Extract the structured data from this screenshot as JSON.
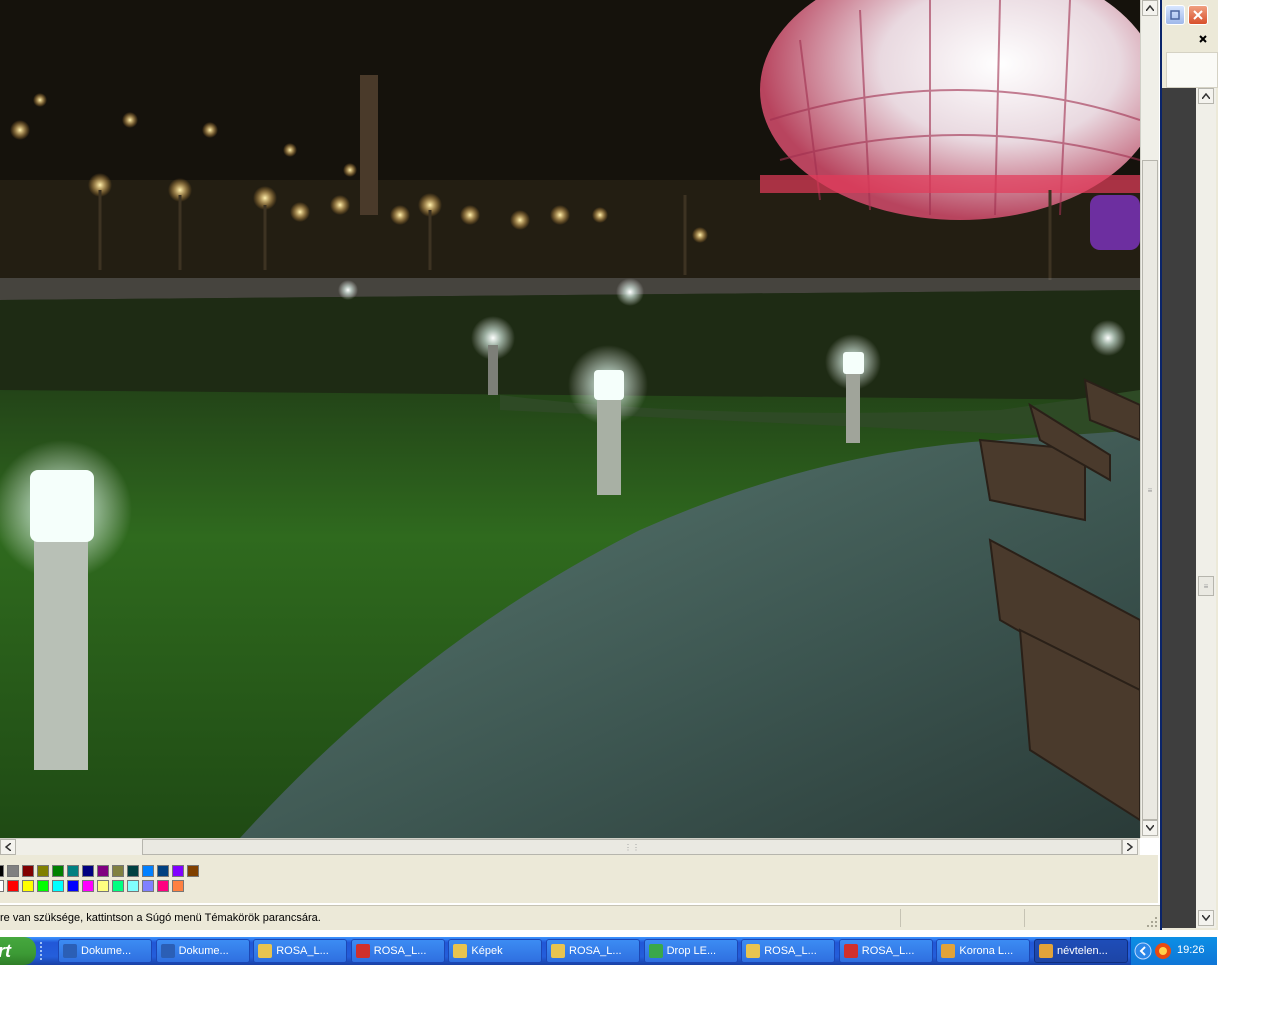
{
  "status_bar": {
    "help_text": "re van szüksége, kattintson a Súgó menü Témakörök parancsára."
  },
  "palette": {
    "row1": [
      "#000000",
      "#808080",
      "#800000",
      "#808000",
      "#008000",
      "#008080",
      "#000080",
      "#800080",
      "#808040",
      "#004040",
      "#0080ff",
      "#004080",
      "#8000ff",
      "#804000"
    ],
    "row2": [
      "#ffffff",
      "#ff0000",
      "#ffff00",
      "#00ff00",
      "#00ffff",
      "#0000ff",
      "#ff00ff",
      "#ffff80",
      "#00ff80",
      "#80ffff",
      "#8080ff",
      "#ff0080",
      "#ff8040"
    ]
  },
  "taskbar": {
    "start_label": "rt",
    "tasks": [
      {
        "label": "Dokume...",
        "icon": "word-icon"
      },
      {
        "label": "Dokume...",
        "icon": "word-icon"
      },
      {
        "label": "ROSA_L...",
        "icon": "folder-icon"
      },
      {
        "label": "ROSA_L...",
        "icon": "pdf-icon"
      },
      {
        "label": "Képek",
        "icon": "image-folder-icon"
      },
      {
        "label": "ROSA_L...",
        "icon": "folder-icon"
      },
      {
        "label": "Drop LE...",
        "icon": "chrome-icon"
      },
      {
        "label": "ROSA_L...",
        "icon": "folder-icon"
      },
      {
        "label": "ROSA_L...",
        "icon": "pdf-icon"
      },
      {
        "label": "Korona L...",
        "icon": "paint-icon"
      },
      {
        "label": "névtelen...",
        "icon": "paint-icon"
      }
    ],
    "clock": "19:26"
  },
  "colors": {
    "taskbar_blue": "#245edb",
    "start_green": "#3c9a35",
    "xp_face": "#ece9d8"
  }
}
